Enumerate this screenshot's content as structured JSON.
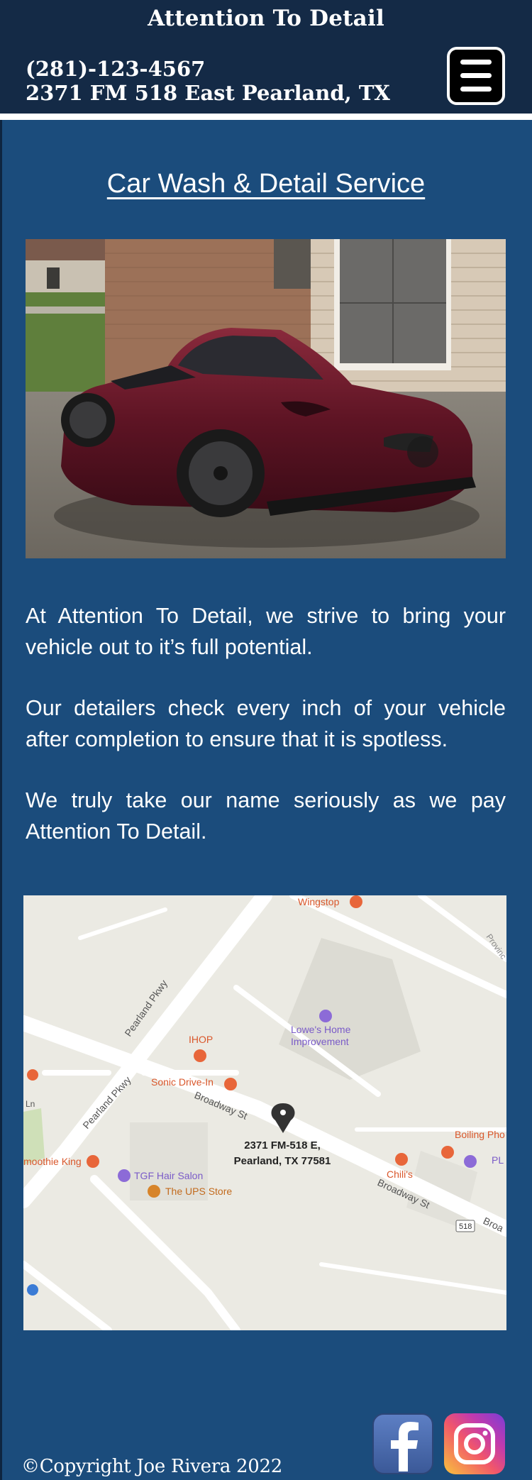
{
  "header": {
    "title": "Attention To Detail",
    "phone": "(281)-123-4567",
    "address": "2371 FM 518 East Pearland, TX"
  },
  "menu": {
    "icon": "hamburger-menu-icon"
  },
  "main": {
    "heading": "Car Wash & Detail Service",
    "paragraphs": [
      "At Attention To Detail, we strive to bring your vehicle out to it’s full potential.",
      "Our detailers check every inch of your vehicle after completion to ensure that it is spotless.",
      "We truly take our name seriously as we pay Attention To Detail."
    ]
  },
  "map": {
    "pin_address_line1": "2371 FM-518 E,",
    "pin_address_line2": "Pearland, TX 77581",
    "places": {
      "wingstop": "Wingstop",
      "lowes_1": "Lowe's Home",
      "lowes_2": "Improvement",
      "ihop": "IHOP",
      "sonic": "Sonic Drive-In",
      "smoothie": "moothie King",
      "tgf": "TGF Hair Salon",
      "ups": "The UPS Store",
      "chilis": "Chili's",
      "boiling": "Boiling Pho",
      "pl": "PL Na",
      "province": "Provinc"
    },
    "streets": {
      "pearland_pkwy_1": "Pearland Pkwy",
      "pearland_pkwy_2": "Pearland Pkwy",
      "broadway_1": "Broadway St",
      "broadway_2": "Broadway St",
      "broadway_3": "Broa",
      "ln": "Ln",
      "route": "518"
    }
  },
  "footer": {
    "copyright": "©Copyright Joe Rivera 2022",
    "social": [
      "facebook-icon",
      "instagram-icon"
    ]
  },
  "colors": {
    "page_bg": "#1b4c7c",
    "header_bg": "#142a46",
    "text": "#ffffff"
  }
}
